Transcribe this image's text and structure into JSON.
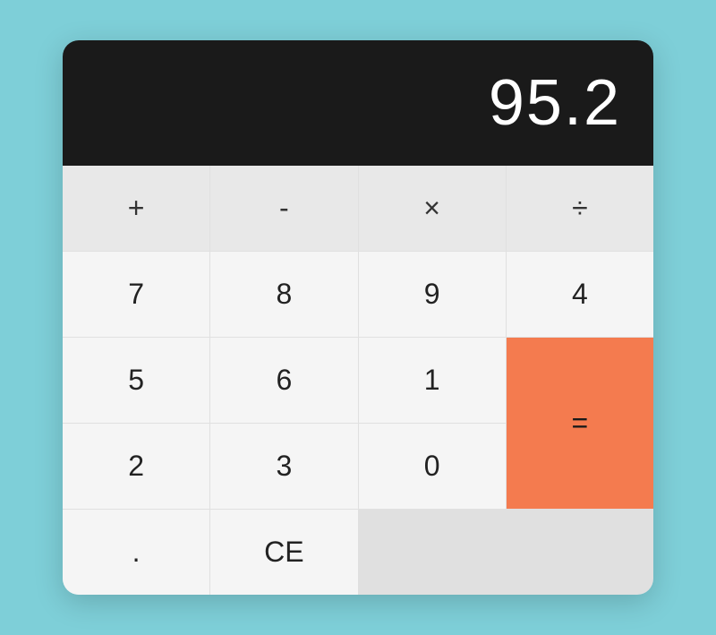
{
  "display": {
    "value": "95.2"
  },
  "buttons": {
    "plus": "+",
    "minus": "-",
    "multiply": "×",
    "divide": "÷",
    "seven": "7",
    "eight": "8",
    "nine": "9",
    "four": "4",
    "five": "5",
    "six": "6",
    "one": "1",
    "two": "2",
    "three": "3",
    "zero": "0",
    "dot": ".",
    "ce": "CE",
    "equals": "="
  },
  "colors": {
    "accent": "#f47b4f",
    "display_bg": "#1a1a1a",
    "display_text": "#ffffff",
    "operator_bg": "#e8e8e8",
    "default_bg": "#f5f5f5"
  }
}
